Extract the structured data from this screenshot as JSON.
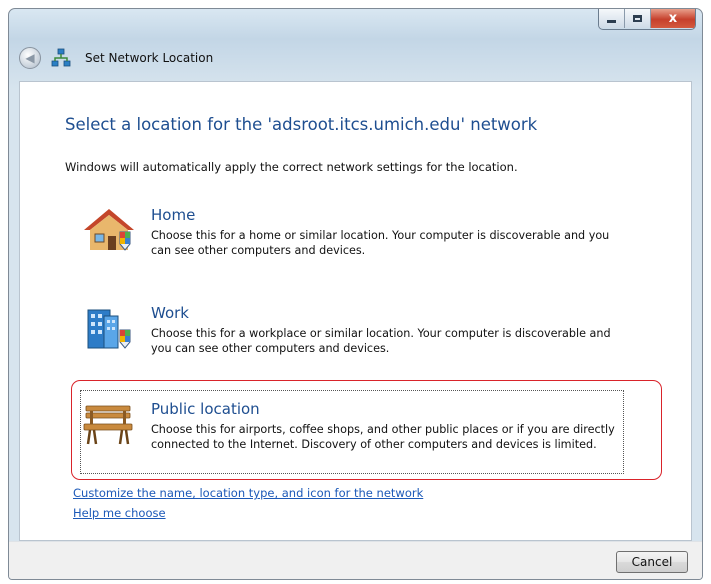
{
  "window": {
    "title": "Set Network Location",
    "close_symbol": "x"
  },
  "nav": {
    "back_icon": "back-arrow-icon",
    "app_icon": "network-icon"
  },
  "content": {
    "heading": "Select a location for the 'adsroot.itcs.umich.edu' network",
    "description": "Windows will automatically apply the correct network settings for the location.",
    "options": [
      {
        "title": "Home",
        "description": "Choose this for a home or similar location. Your computer is discoverable and you can see other computers and devices.",
        "icon": "house-icon"
      },
      {
        "title": "Work",
        "description": "Choose this for a workplace or similar location. Your computer is discoverable and you can see other computers and devices.",
        "icon": "office-building-icon"
      },
      {
        "title": "Public location",
        "description": "Choose this for airports, coffee shops, and other public places or if you are directly connected to the Internet. Discovery of other computers and devices is limited.",
        "icon": "park-bench-icon"
      }
    ],
    "links": {
      "customize": "Customize the name, location type, and icon for the network",
      "help": "Help me choose"
    }
  },
  "footer": {
    "cancel_label": "Cancel"
  },
  "colors": {
    "heading": "#1e4e90",
    "link": "#1c59b8",
    "highlight": "#d9232a"
  }
}
